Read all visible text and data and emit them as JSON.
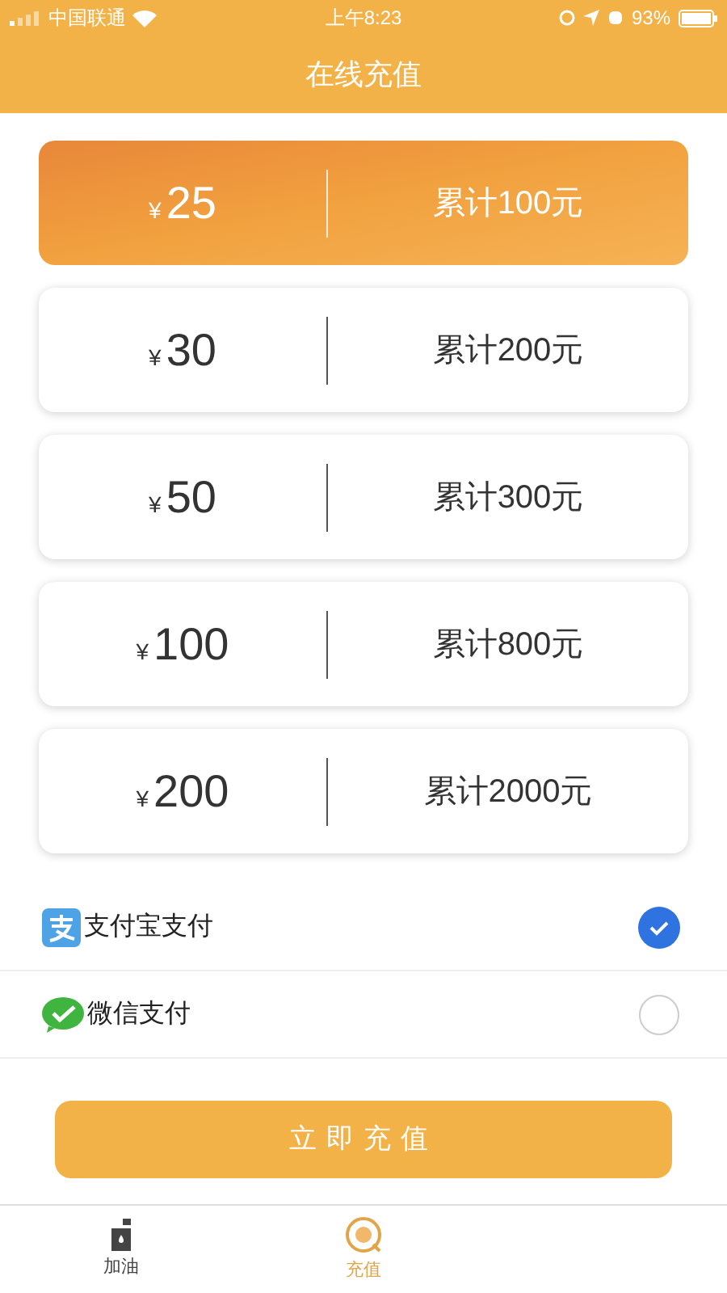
{
  "status_bar": {
    "carrier": "中国联通",
    "time": "上午8:23",
    "battery": "93%"
  },
  "header": {
    "title": "在线充值"
  },
  "options": [
    {
      "currency": "¥",
      "amount": "25",
      "total": "累计100元",
      "selected": true
    },
    {
      "currency": "¥",
      "amount": "30",
      "total": "累计200元",
      "selected": false
    },
    {
      "currency": "¥",
      "amount": "50",
      "total": "累计300元",
      "selected": false
    },
    {
      "currency": "¥",
      "amount": "100",
      "total": "累计800元",
      "selected": false
    },
    {
      "currency": "¥",
      "amount": "200",
      "total": "累计2000元",
      "selected": false
    }
  ],
  "payment_methods": [
    {
      "kind": "alipay",
      "label": "支付宝支付",
      "selected": true
    },
    {
      "kind": "wechat",
      "label": "微信支付",
      "selected": false
    }
  ],
  "submit_button": "立即充值",
  "tab_bar": [
    {
      "kind": "fuel",
      "label": "加油",
      "selected": false
    },
    {
      "kind": "recharge",
      "label": "充值",
      "selected": true
    }
  ]
}
